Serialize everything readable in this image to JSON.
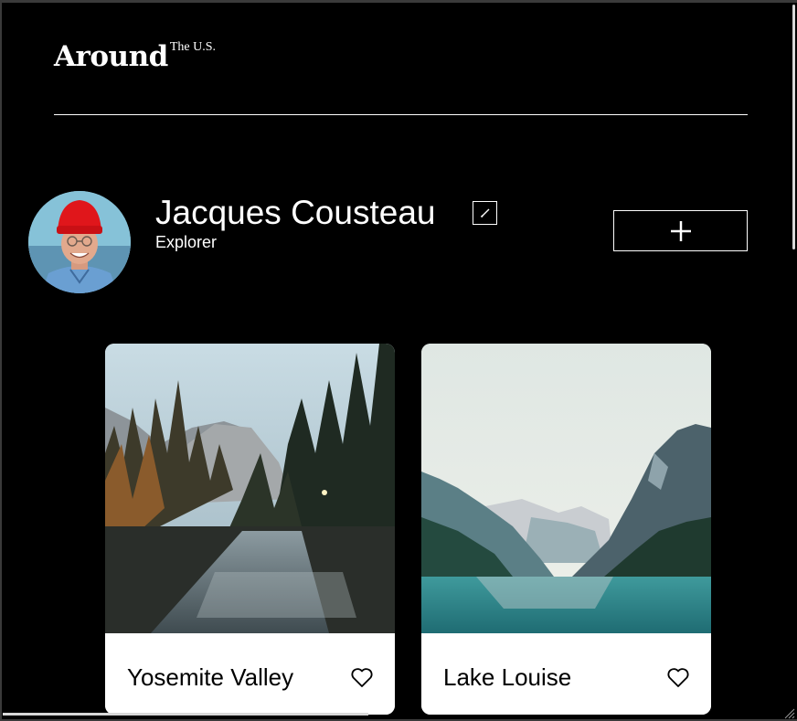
{
  "header": {
    "logo_main": "Around",
    "logo_superscript": "The U.S."
  },
  "profile": {
    "name": "Jacques Cousteau",
    "job": "Explorer",
    "avatar_icon": "avatar-photo",
    "edit_icon": "pencil-icon",
    "add_icon": "plus-icon"
  },
  "cards": [
    {
      "title": "Yosemite Valley",
      "like_icon": "heart-icon"
    },
    {
      "title": "Lake Louise",
      "like_icon": "heart-icon"
    }
  ],
  "colors": {
    "background": "#000000",
    "text": "#ffffff",
    "card_background": "#ffffff",
    "card_text": "#000000"
  }
}
